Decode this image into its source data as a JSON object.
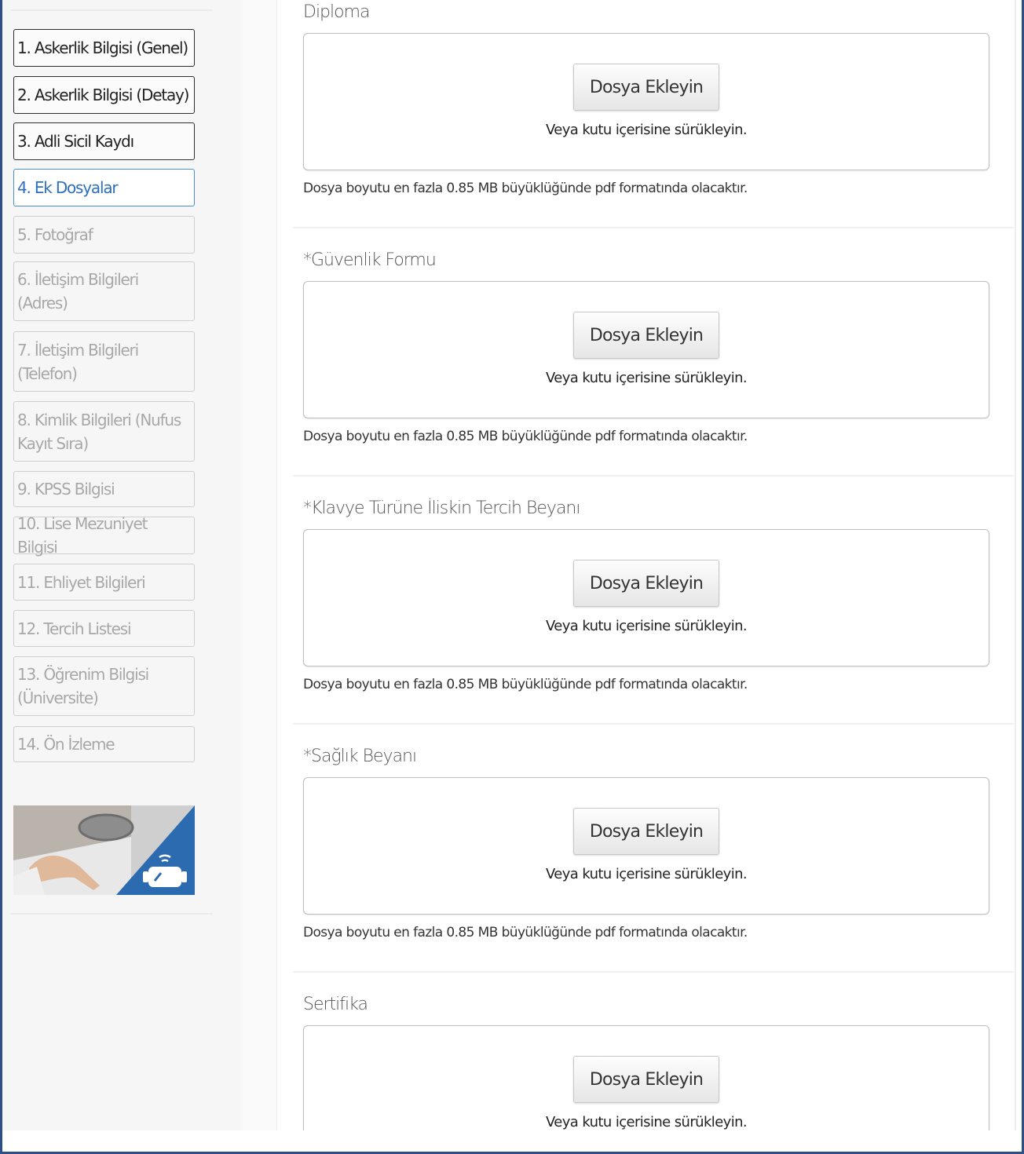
{
  "sidebar": {
    "steps": [
      {
        "label": "1. Askerlik Bilgisi (Genel)",
        "state": "completed"
      },
      {
        "label": "2. Askerlik Bilgisi (Detay)",
        "state": "completed"
      },
      {
        "label": "3. Adli Sicil Kaydı",
        "state": "completed"
      },
      {
        "label": "4. Ek Dosyalar",
        "state": "active"
      },
      {
        "label": "5. Fotoğraf",
        "state": "disabled"
      },
      {
        "label": "6. İletişim Bilgileri (Adres)",
        "state": "disabled"
      },
      {
        "label": "7. İletişim Bilgileri (Telefon)",
        "state": "disabled"
      },
      {
        "label": "8. Kimlik Bilgileri (Nufus Kayıt Sıra)",
        "state": "disabled"
      },
      {
        "label": "9. KPSS Bilgisi",
        "state": "disabled"
      },
      {
        "label": "10. Lise Mezuniyet Bilgisi",
        "state": "disabled"
      },
      {
        "label": "11. Ehliyet Bilgileri",
        "state": "disabled"
      },
      {
        "label": "12. Tercih Listesi",
        "state": "disabled"
      },
      {
        "label": "13. Öğrenim Bilgisi (Üniversite)",
        "state": "disabled"
      },
      {
        "label": "14. Ön İzleme",
        "state": "disabled"
      }
    ],
    "banner_icon": "vr-headset-icon"
  },
  "uploads": [
    {
      "title": "Diploma"
    },
    {
      "title": "*Güvenlik Formu"
    },
    {
      "title": "*Klavye Türüne İliskin Tercih Beyanı"
    },
    {
      "title": "*Sağlık Beyanı"
    },
    {
      "title": "Sertifika"
    }
  ],
  "common": {
    "add_button": "Dosya Ekleyin",
    "drag_hint": "Veya kutu içerisine sürükleyin.",
    "size_note": "Dosya boyutu en fazla 0.85 MB büyüklüğünde pdf formatında olacaktır."
  },
  "colors": {
    "frame_border": "#2b4f86",
    "active_step": "#2c6fc0",
    "active_border": "#4a90d9",
    "disabled_text": "#a8a8a8",
    "banner_blue": "#2d6bb0"
  }
}
